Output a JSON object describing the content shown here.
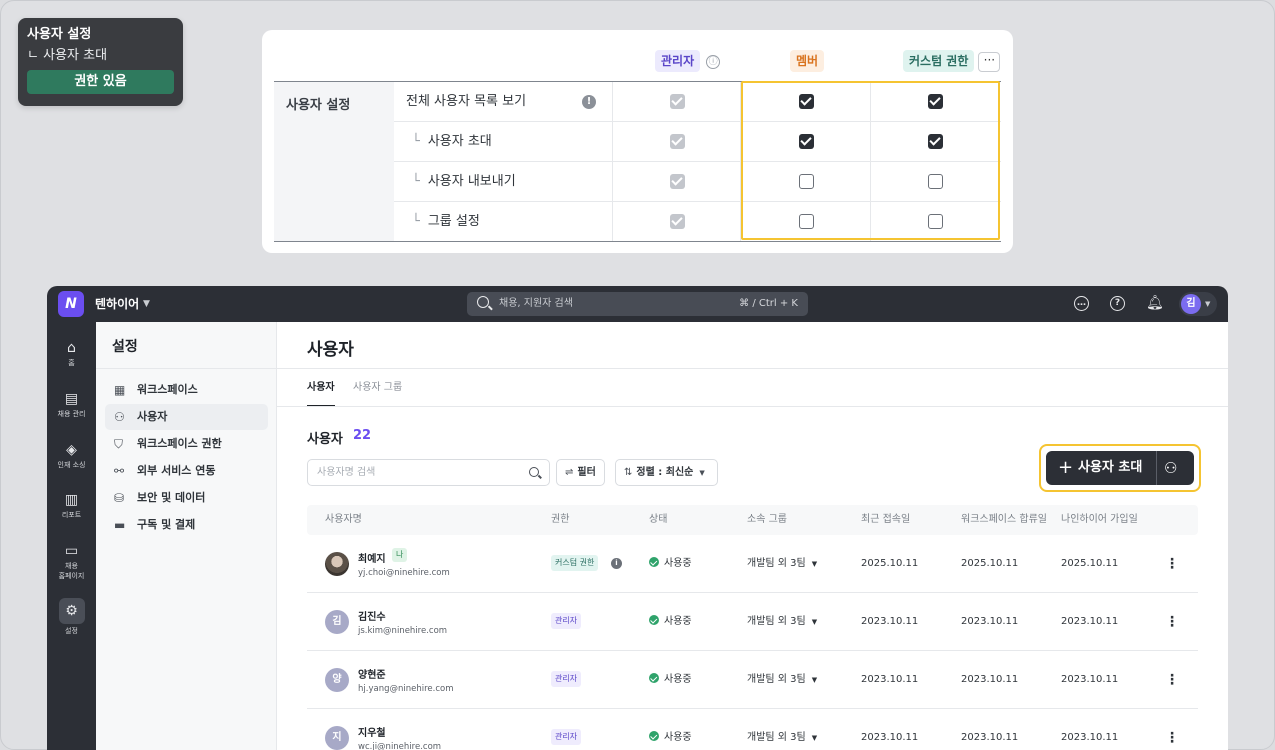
{
  "callout": {
    "title": "사용자 설정",
    "sub": "ㄴ 사용자 초대",
    "badge": "권한 있음"
  },
  "permissions": {
    "roles": {
      "admin": "관리자",
      "member": "멤버",
      "custom": "커스텀 권한"
    },
    "info_icon": "ⓘ",
    "more_icon": "···",
    "category": "사용자 설정",
    "rows": [
      {
        "label": "전체 사용자 목록 보기",
        "admin": "checked-disabled",
        "member": "checked",
        "custom": "checked"
      },
      {
        "label": "사용자 초대",
        "admin": "checked-disabled",
        "member": "checked",
        "custom": "checked"
      },
      {
        "label": "사용자 내보내기",
        "admin": "checked-disabled",
        "member": "unchecked",
        "custom": "unchecked"
      },
      {
        "label": "그룹 설정",
        "admin": "checked-disabled",
        "member": "unchecked",
        "custom": "unchecked"
      }
    ],
    "elbow": "└",
    "warn_icon": "!"
  },
  "topbar": {
    "logo": "N",
    "workspace": "텐하이어",
    "search_placeholder": "채용, 지원자 검색",
    "shortcut": "⌘ / Ctrl + K",
    "avatar": "김",
    "icons": [
      "chat-icon",
      "help-icon",
      "bell-icon"
    ]
  },
  "rail": [
    {
      "icon": "⌂",
      "label": "홈"
    },
    {
      "icon": "▤",
      "label": "채용 관리"
    },
    {
      "icon": "◈",
      "label": "인재 소싱"
    },
    {
      "icon": "▥",
      "label": "리포트"
    },
    {
      "icon": "▭",
      "label": "채용\n홈페이지"
    },
    {
      "icon": "⚙",
      "label": "설정"
    }
  ],
  "sidebar": {
    "title": "설정",
    "items": [
      {
        "icon": "▦",
        "label": "워크스페이스"
      },
      {
        "icon": "⚇",
        "label": "사용자"
      },
      {
        "icon": "⛉",
        "label": "워크스페이스 권한"
      },
      {
        "icon": "⚯",
        "label": "외부 서비스 연동"
      },
      {
        "icon": "⛁",
        "label": "보안 및 데이터"
      },
      {
        "icon": "▬",
        "label": "구독 및 결제"
      }
    ]
  },
  "main": {
    "title": "사용자",
    "tabs": [
      "사용자",
      "사용자 그룹"
    ],
    "count_label": "사용자",
    "count": "22",
    "search_placeholder": "사용자명 검색",
    "filter_label": "필터",
    "sort_label": "정렬 : 최신순",
    "invite_label": "사용자 초대",
    "columns": [
      "사용자명",
      "권한",
      "상태",
      "소속 그룹",
      "최근 접속일",
      "워크스페이스 합류일",
      "나인하이어 가입일"
    ],
    "users": [
      {
        "avatar": "",
        "name": "최예지",
        "me": "나",
        "email": "yj.choi@ninehire.com",
        "role": "커스텀 권한",
        "status": "사용중",
        "group": "개발팀 외 3팀",
        "last": "2025.10.11",
        "joined": "2025.10.11",
        "signup": "2025.10.11"
      },
      {
        "avatar": "김",
        "name": "김진수",
        "me": "",
        "email": "js.kim@ninehire.com",
        "role": "관리자",
        "status": "사용중",
        "group": "개발팀 외 3팀",
        "last": "2023.10.11",
        "joined": "2023.10.11",
        "signup": "2023.10.11"
      },
      {
        "avatar": "양",
        "name": "양현준",
        "me": "",
        "email": "hj.yang@ninehire.com",
        "role": "관리자",
        "status": "사용중",
        "group": "개발팀 외 3팀",
        "last": "2023.10.11",
        "joined": "2023.10.11",
        "signup": "2023.10.11"
      },
      {
        "avatar": "지",
        "name": "지우철",
        "me": "",
        "email": "wc.ji@ninehire.com",
        "role": "관리자",
        "status": "사용중",
        "group": "개발팀 외 3팀",
        "last": "2023.10.11",
        "joined": "2023.10.11",
        "signup": "2023.10.11"
      }
    ]
  },
  "colors": {
    "accent": "#6b4ef0",
    "highlight": "#f5c431",
    "dark": "#2c2f36",
    "active": "#2fa36b"
  }
}
